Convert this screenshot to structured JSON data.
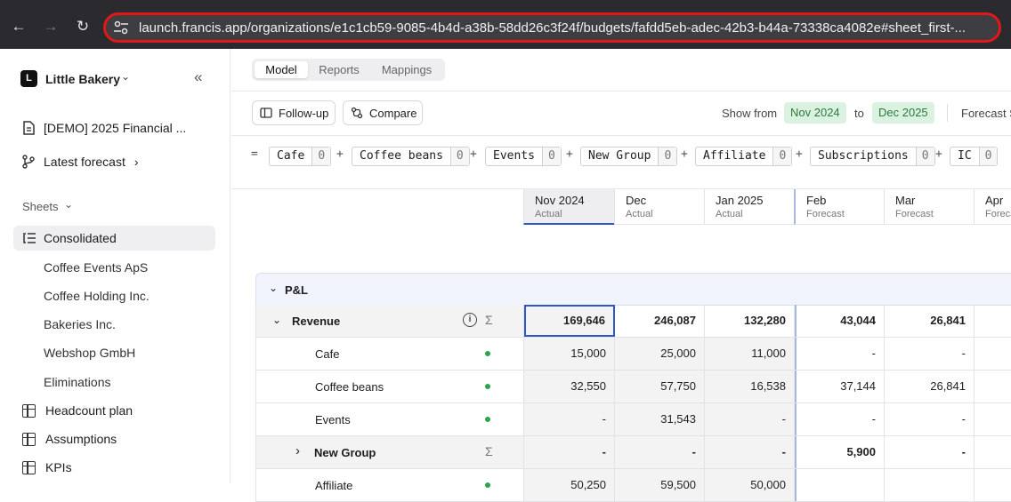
{
  "browser": {
    "url": "launch.francis.app/organizations/e1c1cb59-9085-4b4d-a38b-58dd26c3f24f/budgets/fafdd5eb-adec-42b3-b44a-73338ca4082e#sheet_first-..."
  },
  "sidebar": {
    "org_name": "Little Bakery",
    "org_initial": "L",
    "budget": "[DEMO] 2025 Financial ...",
    "forecast": "Latest forecast",
    "sheets_label": "Sheets",
    "consolidated": "Consolidated",
    "subsidiaries": [
      "Coffee Events ApS",
      "Coffee Holding Inc.",
      "Bakeries Inc.",
      "Webshop GmbH",
      "Eliminations"
    ],
    "pages": [
      "Headcount plan",
      "Assumptions",
      "KPIs"
    ]
  },
  "toolbar": {
    "tabs": [
      "Model",
      "Reports",
      "Mappings"
    ],
    "follow_up": "Follow-up",
    "compare": "Compare",
    "show_from": "Show from",
    "from": "Nov 2024",
    "to_label": "to",
    "to": "Dec 2025",
    "forecast_label": "Forecast S"
  },
  "formula": {
    "items": [
      {
        "label": "Cafe",
        "count": "0"
      },
      {
        "label": "Coffee beans",
        "count": "0"
      },
      {
        "label": "Events",
        "count": "0"
      },
      {
        "label": "New Group",
        "count": "0"
      },
      {
        "label": "Affiliate",
        "count": "0"
      },
      {
        "label": "Subscriptions",
        "count": "0"
      },
      {
        "label": "IC",
        "count": "0"
      }
    ],
    "eq": "=",
    "plus": "+"
  },
  "columns": [
    {
      "month": "Nov 2024",
      "type": "Actual"
    },
    {
      "month": "Dec",
      "type": "Actual"
    },
    {
      "month": "Jan 2025",
      "type": "Actual"
    },
    {
      "month": "Feb",
      "type": "Forecast"
    },
    {
      "month": "Mar",
      "type": "Forecast"
    },
    {
      "month": "Apr",
      "type": "Forecast"
    }
  ],
  "table": {
    "section": "P&L",
    "rows": [
      {
        "name": "Revenue",
        "values": [
          "169,646",
          "246,087",
          "132,280",
          "43,044",
          "26,841",
          ""
        ]
      },
      {
        "name": "Cafe",
        "values": [
          "15,000",
          "25,000",
          "11,000",
          "-",
          "-",
          ""
        ]
      },
      {
        "name": "Coffee beans",
        "values": [
          "32,550",
          "57,750",
          "16,538",
          "37,144",
          "26,841",
          ""
        ]
      },
      {
        "name": "Events",
        "values": [
          "-",
          "31,543",
          "-",
          "-",
          "-",
          ""
        ]
      },
      {
        "name": "New Group",
        "values": [
          "-",
          "-",
          "-",
          "5,900",
          "-",
          ""
        ]
      },
      {
        "name": "Affiliate",
        "values": [
          "50,250",
          "59,500",
          "50,000",
          "",
          "",
          ""
        ]
      }
    ]
  },
  "colors": {
    "accent": "#2f56c6",
    "actual_bg": "#f3f3f4",
    "pill_bg": "#dcf2e0",
    "pill_text": "#2b7a3c",
    "status_dot": "#2aa54a"
  }
}
